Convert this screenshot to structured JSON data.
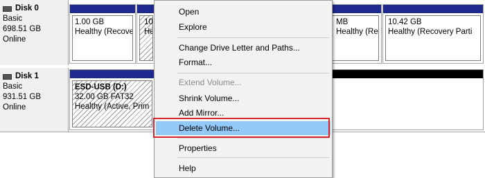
{
  "disks": [
    {
      "name": "Disk 0",
      "type": "Basic",
      "size": "698.51 GB",
      "status": "Online",
      "volumes": [
        {
          "lines": [
            "1.00 GB",
            "Healthy (Recove"
          ]
        },
        {
          "lines": [
            "10(",
            "He"
          ]
        },
        {
          "lines": [
            "MB",
            "Healthy (Recove"
          ]
        },
        {
          "lines": [
            "10.42 GB",
            "Healthy (Recovery Parti"
          ]
        }
      ]
    },
    {
      "name": "Disk 1",
      "type": "Basic",
      "size": "931.51 GB",
      "status": "Online",
      "volumes": [
        {
          "lines": [
            "ESD-USB  (D:)",
            "32.00 GB FAT32",
            "Healthy (Active, Prim"
          ]
        }
      ]
    }
  ],
  "context_menu": {
    "items": [
      {
        "label": "Open",
        "enabled": true
      },
      {
        "label": "Explore",
        "enabled": true
      },
      {
        "label": "Change Drive Letter and Paths...",
        "enabled": true
      },
      {
        "label": "Format...",
        "enabled": true
      },
      {
        "label": "Extend Volume...",
        "enabled": false
      },
      {
        "label": "Shrink Volume...",
        "enabled": true
      },
      {
        "label": "Add Mirror...",
        "enabled": true
      },
      {
        "label": "Delete Volume...",
        "enabled": true,
        "highlighted": true
      },
      {
        "label": "Properties",
        "enabled": true
      },
      {
        "label": "Help",
        "enabled": true
      }
    ]
  },
  "colors": {
    "primary_partition_bar": "#1f2a8f",
    "unallocated_bar": "#000000",
    "menu_highlight": "#91c9f7",
    "annotation_box": "#d9262c"
  }
}
